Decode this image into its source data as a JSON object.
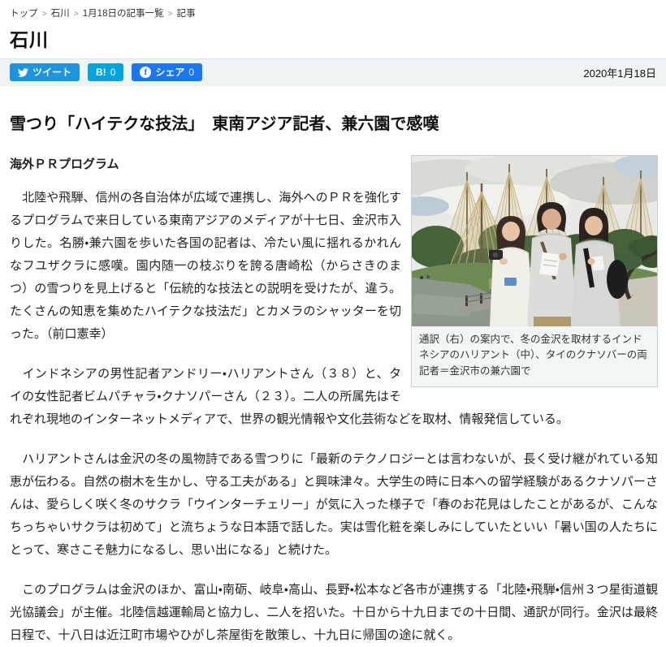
{
  "breadcrumb": {
    "separator": ">",
    "items": [
      "トップ",
      "石川",
      "1月18日の記事一覧",
      "記事"
    ]
  },
  "page": {
    "section_title": "石川",
    "date": "2020年1月18日"
  },
  "share": {
    "tweet_label": "ツイート",
    "hatena_label": "B!",
    "hatena_count": "0",
    "facebook_label": "シェア",
    "facebook_count": "0"
  },
  "article": {
    "title": "雪つり「ハイテクな技法」　東南アジア記者、兼六園で感嘆",
    "subhead": "海外ＰＲプログラム",
    "paragraphs": [
      "　北陸や飛騨、信州の各自治体が広域で連携し、海外へのＰＲを強化するプログラムで来日している東南アジアのメディアが十七日、金沢市入りした。名勝・兼六園を歩いた各国の記者は、冷たい風に揺れるかれんなフユザクラに感嘆。園内随一の枝ぶりを誇る唐崎松（からさきのまつ）の雪つりを見上げると「伝統的な技法との説明を受けたが、違う。たくさんの知恵を集めたハイテクな技法だ」とカメラのシャッターを切った。（前口憲幸）",
      "　インドネシアの男性記者アンドリー・ハリアントさん（３８）と、タイの女性記者ビムパチャラ・クナソパーさん（２３）。二人の所属先はそれぞれ現地のインターネットメディアで、世界の観光情報や文化芸術などを取材、情報発信している。",
      "　ハリアントさんは金沢の冬の風物詩である雪つりに「最新のテクノロジーとは言わないが、長く受け継がれている知恵が伝わる。自然の樹木を生かし、守る工夫がある」と興味津々。大学生の時に日本への留学経験があるクナソパーさんは、愛らしく咲く冬のサクラ「ウインターチェリー」が気に入った様子で「春のお花見はしたことがあるが、こんなちっちゃいサクラは初めて」と流ちょうな日本語で話した。実は雪化粧を楽しみにしていたといい「暑い国の人たちにとって、寒さこそ魅力になるし、思い出になる」と続けた。",
      "　このプログラムは金沢のほか、富山・南砺、岐阜・高山、長野・松本など各市が連携する「北陸・飛騨・信州３つ星街道観光協議会」が主催。北陸信越運輸局と協力し、二人を招いた。十日から十九日までの十日間、通訳が同行。金沢は最終日程で、十八日は近江町市場やひがし茶屋街を散策し、十九日に帰国の途に就く。"
    ],
    "photo_caption": "通訳（右）の案内で、冬の金沢を取材するインドネシアのハリアント（中）、タイのクナソバーの両記者＝金沢市の兼六園で"
  },
  "colors": {
    "twitter_blue": "#1b95e0",
    "hatena_blue": "#00a4de",
    "facebook_blue": "#1877f2",
    "share_bar_bg": "#eef3f4",
    "figure_border": "#c9d1d4",
    "caption_bg": "#f2f5f5",
    "body_text": "#222222"
  }
}
